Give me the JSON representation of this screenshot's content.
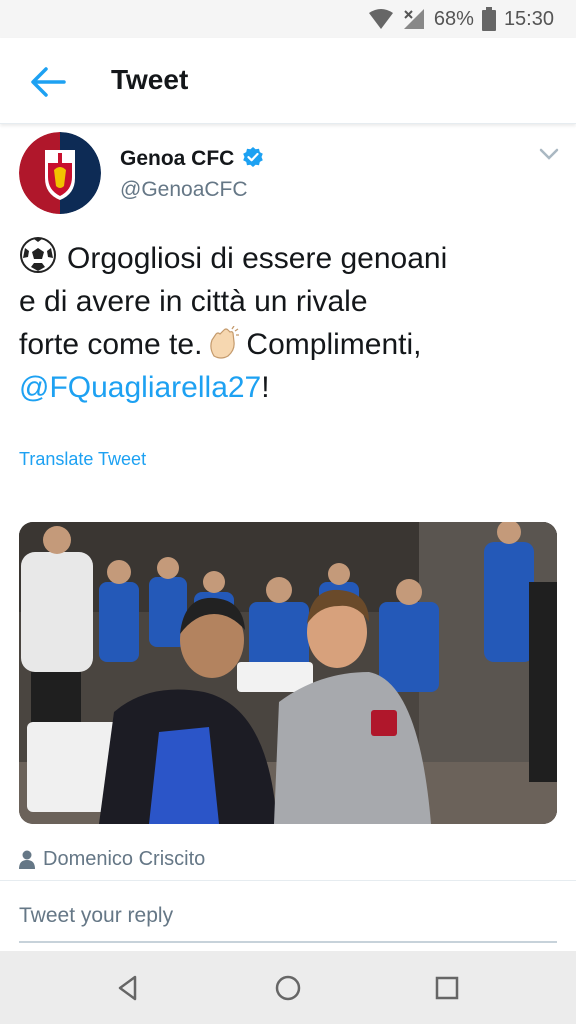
{
  "status_bar": {
    "battery": "68%",
    "time": "15:30"
  },
  "app_bar": {
    "title": "Tweet"
  },
  "tweet": {
    "author_name": "Genoa CFC",
    "handle": "@GenoaCFC",
    "line1": "Orgogliosi di essere genoani",
    "line2": "e di avere in città un rivale",
    "line3_a": "forte come te.",
    "line3_b": "Complimenti,",
    "mention": "@FQuagliarella27",
    "mention_suffix": "!",
    "translate_label": "Translate Tweet",
    "tagged_user": "Domenico Criscito"
  },
  "reply": {
    "placeholder": "Tweet your reply"
  },
  "colors": {
    "accent": "#1da1f2",
    "secondary_text": "#657786",
    "primary_text": "#14171a"
  },
  "icons": {
    "back": "arrow-left-icon",
    "verified": "verified-badge-icon",
    "caret": "chevron-down-icon",
    "soccer": "soccer-ball-emoji",
    "clap": "clapping-hands-emoji",
    "person": "person-icon",
    "wifi": "wifi-icon",
    "signal": "signal-icon",
    "battery": "battery-icon",
    "nav_back": "nav-back-icon",
    "nav_home": "nav-home-icon",
    "nav_recents": "nav-recents-icon"
  }
}
